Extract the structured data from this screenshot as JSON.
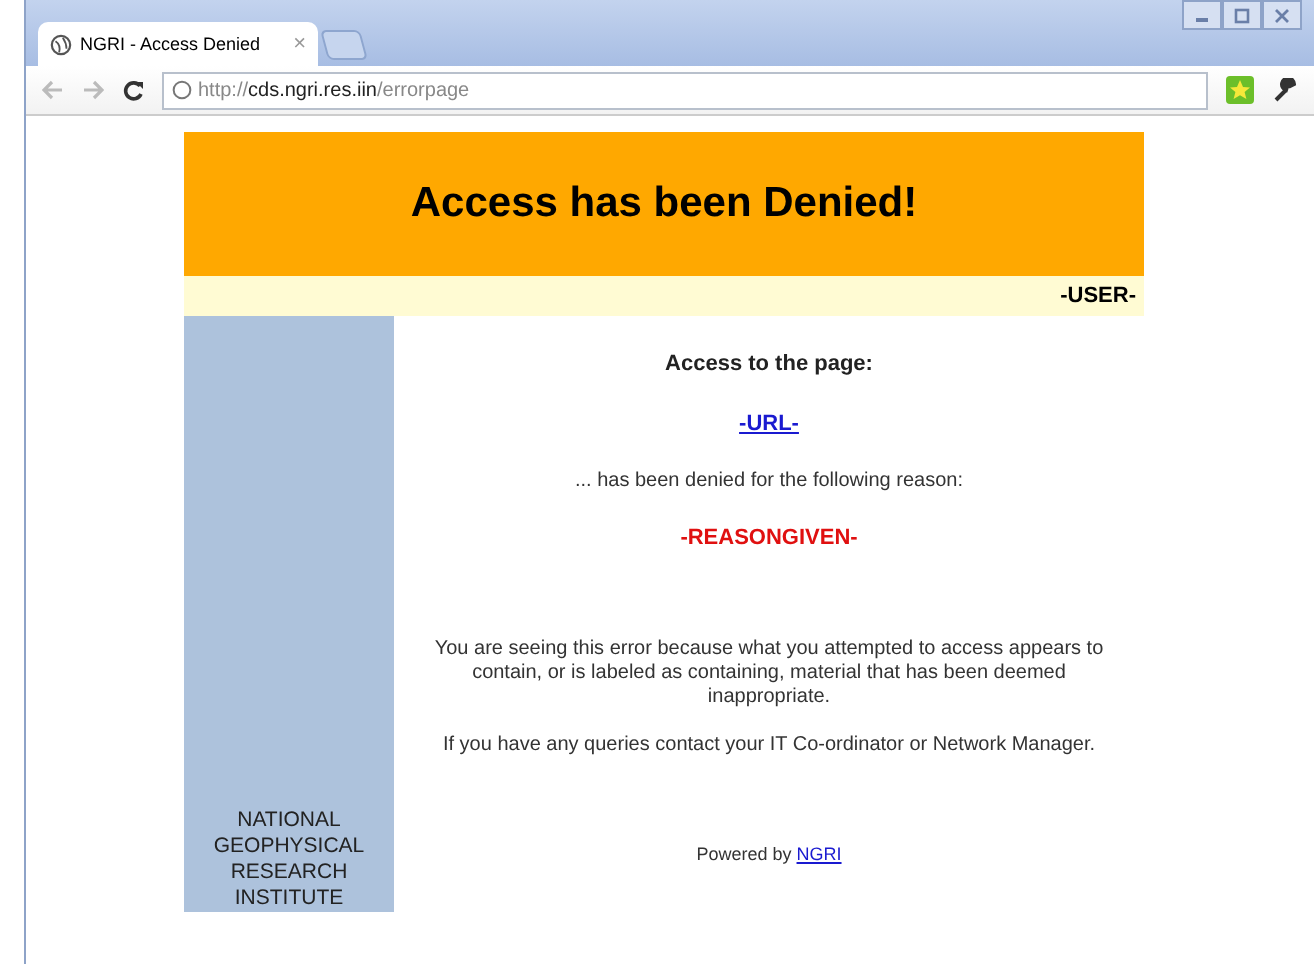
{
  "browser": {
    "tab": {
      "title": "NGRI - Access Denied",
      "close": "×"
    },
    "address": {
      "scheme": "http://",
      "host": "cds.ngri.res.iin",
      "path": "/errorpage"
    }
  },
  "page": {
    "heading": "Access has been Denied!",
    "user": "-USER-",
    "sidebar_text": "NATIONAL GEOPHYSICAL RESEARCH INSTITUTE",
    "access_label": "Access to the page:",
    "url_link": "-URL-",
    "denied_text": "... has been denied for the following reason:",
    "reason": "-REASONGIVEN-",
    "explanation": "You are seeing this error because what you attempted to access appears to contain, or is labeled as containing, material that has been deemed inappropriate.",
    "queries": "If you have any queries contact your IT Co-ordinator or Network Manager.",
    "powered_by": "Powered by",
    "powered_link": "NGRI"
  }
}
